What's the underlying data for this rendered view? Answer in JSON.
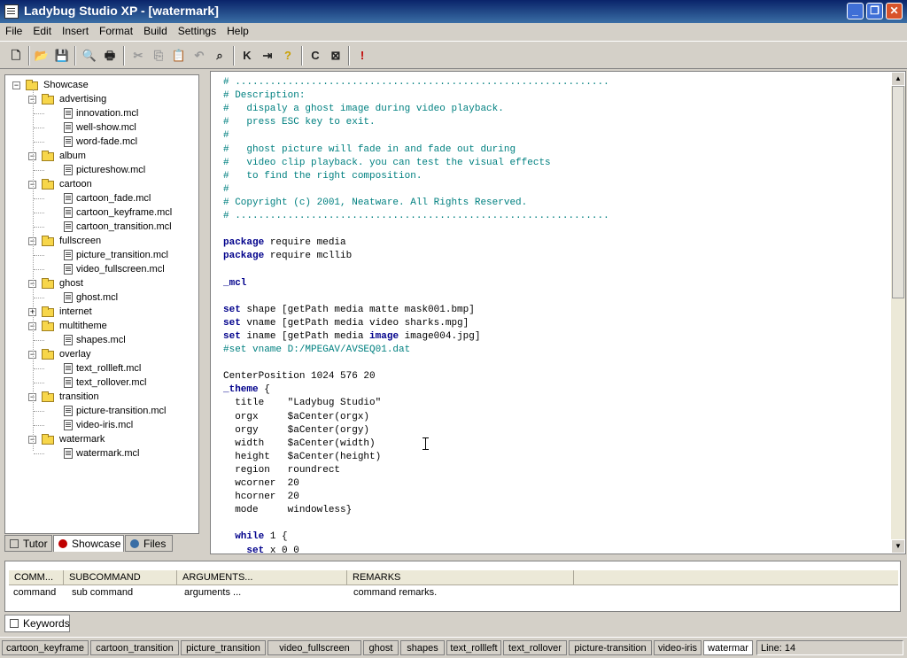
{
  "window": {
    "title": "Ladybug Studio XP - [watermark]"
  },
  "menu": [
    "File",
    "Edit",
    "Insert",
    "Format",
    "Build",
    "Settings",
    "Help"
  ],
  "tree": [
    {
      "label": "Showcase",
      "level": 0,
      "type": "folder",
      "expanded": true
    },
    {
      "label": "advertising",
      "level": 1,
      "type": "folder",
      "expanded": true
    },
    {
      "label": "innovation.mcl",
      "level": 2,
      "type": "file"
    },
    {
      "label": "well-show.mcl",
      "level": 2,
      "type": "file"
    },
    {
      "label": "word-fade.mcl",
      "level": 2,
      "type": "file"
    },
    {
      "label": "album",
      "level": 1,
      "type": "folder",
      "expanded": true
    },
    {
      "label": "pictureshow.mcl",
      "level": 2,
      "type": "file"
    },
    {
      "label": "cartoon",
      "level": 1,
      "type": "folder",
      "expanded": true
    },
    {
      "label": "cartoon_fade.mcl",
      "level": 2,
      "type": "file"
    },
    {
      "label": "cartoon_keyframe.mcl",
      "level": 2,
      "type": "file"
    },
    {
      "label": "cartoon_transition.mcl",
      "level": 2,
      "type": "file"
    },
    {
      "label": "fullscreen",
      "level": 1,
      "type": "folder",
      "expanded": true
    },
    {
      "label": "picture_transition.mcl",
      "level": 2,
      "type": "file"
    },
    {
      "label": "video_fullscreen.mcl",
      "level": 2,
      "type": "file"
    },
    {
      "label": "ghost",
      "level": 1,
      "type": "folder",
      "expanded": true
    },
    {
      "label": "ghost.mcl",
      "level": 2,
      "type": "file"
    },
    {
      "label": "internet",
      "level": 1,
      "type": "folder",
      "expanded": false
    },
    {
      "label": "multitheme",
      "level": 1,
      "type": "folder",
      "expanded": true
    },
    {
      "label": "shapes.mcl",
      "level": 2,
      "type": "file"
    },
    {
      "label": "overlay",
      "level": 1,
      "type": "folder",
      "expanded": true
    },
    {
      "label": "text_rollleft.mcl",
      "level": 2,
      "type": "file"
    },
    {
      "label": "text_rollover.mcl",
      "level": 2,
      "type": "file"
    },
    {
      "label": "transition",
      "level": 1,
      "type": "folder",
      "expanded": true
    },
    {
      "label": "picture-transition.mcl",
      "level": 2,
      "type": "file"
    },
    {
      "label": "video-iris.mcl",
      "level": 2,
      "type": "file"
    },
    {
      "label": "watermark",
      "level": 1,
      "type": "folder",
      "expanded": true
    },
    {
      "label": "watermark.mcl",
      "level": 2,
      "type": "file"
    }
  ],
  "left_tabs": [
    "Tutor",
    "Showcase",
    "Files"
  ],
  "code": [
    [
      [
        "c",
        "# ................................................................"
      ]
    ],
    [
      [
        "c",
        "# Description:"
      ]
    ],
    [
      [
        "c",
        "#   dispaly a ghost image during video playback."
      ]
    ],
    [
      [
        "c",
        "#   press ESC key to exit."
      ]
    ],
    [
      [
        "c",
        "#"
      ]
    ],
    [
      [
        "c",
        "#   ghost picture will fade in and fade out during"
      ]
    ],
    [
      [
        "c",
        "#   video clip playback. you can test the visual effects"
      ]
    ],
    [
      [
        "c",
        "#   to find the right composition."
      ]
    ],
    [
      [
        "c",
        "#"
      ]
    ],
    [
      [
        "c",
        "# Copyright (c) 2001, Neatware. All Rights Reserved."
      ]
    ],
    [
      [
        "c",
        "# ................................................................"
      ]
    ],
    [],
    [
      [
        "k",
        "package"
      ],
      [
        "t",
        " require media"
      ]
    ],
    [
      [
        "k",
        "package"
      ],
      [
        "t",
        " require mcllib"
      ]
    ],
    [],
    [
      [
        "k",
        "_mcl"
      ]
    ],
    [],
    [
      [
        "k",
        "set"
      ],
      [
        "t",
        " shape [getPath media matte mask001.bmp]"
      ]
    ],
    [
      [
        "k",
        "set"
      ],
      [
        "t",
        " vname [getPath media video sharks.mpg]"
      ]
    ],
    [
      [
        "k",
        "set"
      ],
      [
        "t",
        " iname [getPath media "
      ],
      [
        "k",
        "image"
      ],
      [
        "t",
        " image004.jpg]"
      ]
    ],
    [
      [
        "c",
        "#set vname D:/MPEGAV/AVSEQ01.dat"
      ]
    ],
    [],
    [
      [
        "t",
        "CenterPosition 1024 576 20"
      ]
    ],
    [
      [
        "k",
        "_theme"
      ],
      [
        "t",
        " {"
      ]
    ],
    [
      [
        "t",
        "  title    \"Ladybug Studio\""
      ]
    ],
    [
      [
        "t",
        "  orgx     $aCenter(orgx)"
      ]
    ],
    [
      [
        "t",
        "  orgy     $aCenter(orgy)"
      ]
    ],
    [
      [
        "t",
        "  width    $aCenter(width)"
      ]
    ],
    [
      [
        "t",
        "  height   $aCenter(height)"
      ]
    ],
    [
      [
        "t",
        "  region   roundrect"
      ]
    ],
    [
      [
        "t",
        "  wcorner  20"
      ]
    ],
    [
      [
        "t",
        "  hcorner  20"
      ]
    ],
    [
      [
        "t",
        "  mode     windowless}"
      ]
    ],
    [],
    [
      [
        "t",
        "  "
      ],
      [
        "k",
        "while"
      ],
      [
        "t",
        " 1 {"
      ]
    ],
    [
      [
        "t",
        "    "
      ],
      [
        "k",
        "set"
      ],
      [
        "t",
        " x 0 0"
      ]
    ]
  ],
  "columns": [
    {
      "header": "COMM...",
      "value": "command"
    },
    {
      "header": "SUBCOMMAND",
      "value": "sub command"
    },
    {
      "header": "ARGUMENTS...",
      "value": "arguments ..."
    },
    {
      "header": "REMARKS",
      "value": "command remarks."
    }
  ],
  "keywords_tab": "Keywords",
  "bottom_tabs": [
    "cartoon_keyframe",
    "cartoon_transition",
    "picture_transition",
    "video_fullscreen",
    "ghost",
    "shapes",
    "text_rollleft",
    "text_rollover",
    "picture-transition",
    "video-iris",
    "watermar"
  ],
  "status": {
    "line": "Line: 14"
  },
  "colors": {
    "comment": "#008080",
    "keyword": "#00008b",
    "title_bar": "#0a246a"
  }
}
